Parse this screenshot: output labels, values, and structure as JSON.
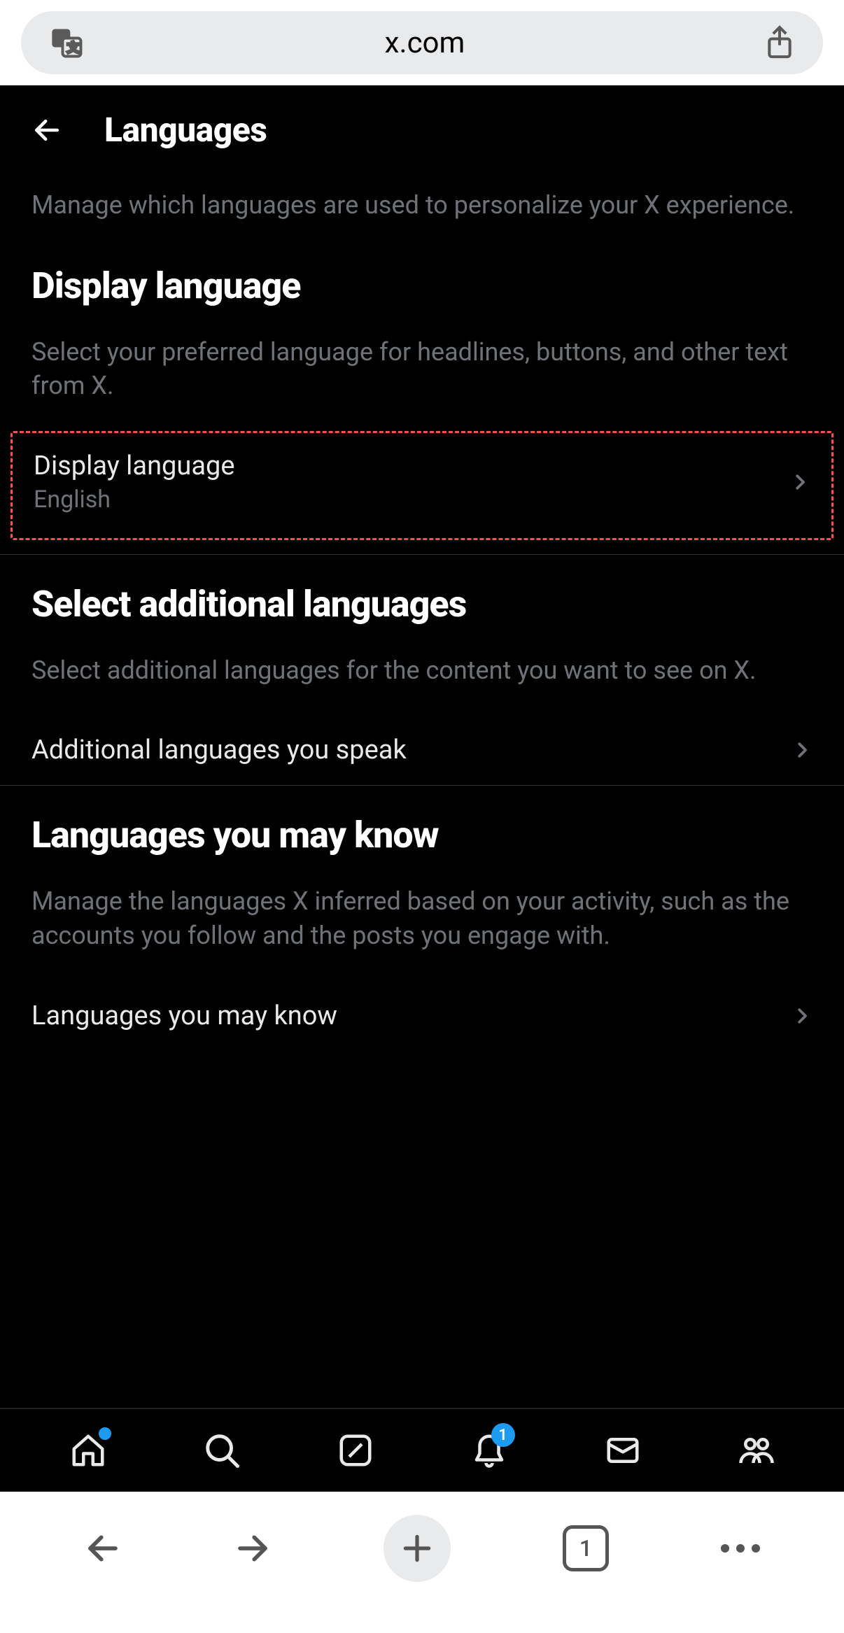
{
  "browser": {
    "url": "x.com",
    "tab_count": "1"
  },
  "header": {
    "title": "Languages"
  },
  "page": {
    "description": "Manage which languages are used to personalize your X experience."
  },
  "sections": {
    "display": {
      "title": "Display language",
      "description": "Select your preferred language for headlines, buttons, and other text from X.",
      "row_label": "Display language",
      "row_value": "English"
    },
    "additional": {
      "title": "Select additional languages",
      "description": "Select additional languages for the content you want to see on X.",
      "row_label": "Additional languages you speak"
    },
    "inferred": {
      "title": "Languages you may know",
      "description": "Manage the languages X inferred based on your activity, such as the accounts you follow and the posts you engage with.",
      "row_label": "Languages you may know"
    }
  },
  "nav": {
    "notification_count": "1"
  }
}
